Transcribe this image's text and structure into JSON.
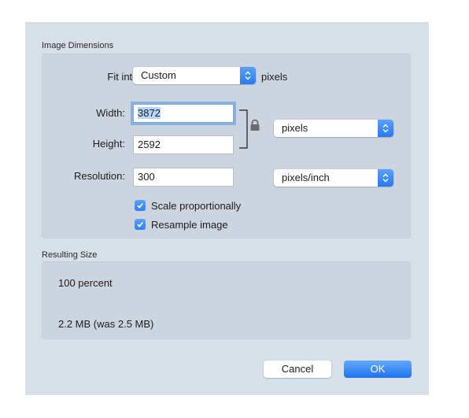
{
  "dimensions": {
    "section_title": "Image Dimensions",
    "fit_into": {
      "label": "Fit into:",
      "value": "Custom",
      "unit": "pixels"
    },
    "width": {
      "label": "Width:",
      "value": "3872"
    },
    "height": {
      "label": "Height:",
      "value": "2592"
    },
    "size_unit": {
      "value": "pixels"
    },
    "resolution": {
      "label": "Resolution:",
      "value": "300",
      "unit": "pixels/inch"
    },
    "scale_proportionally": {
      "label": "Scale proportionally",
      "checked": true
    },
    "resample_image": {
      "label": "Resample image",
      "checked": true
    }
  },
  "resulting": {
    "section_title": "Resulting Size",
    "percent": "100 percent",
    "file_size": "2.2 MB (was 2.5 MB)"
  },
  "buttons": {
    "cancel": "Cancel",
    "ok": "OK"
  }
}
